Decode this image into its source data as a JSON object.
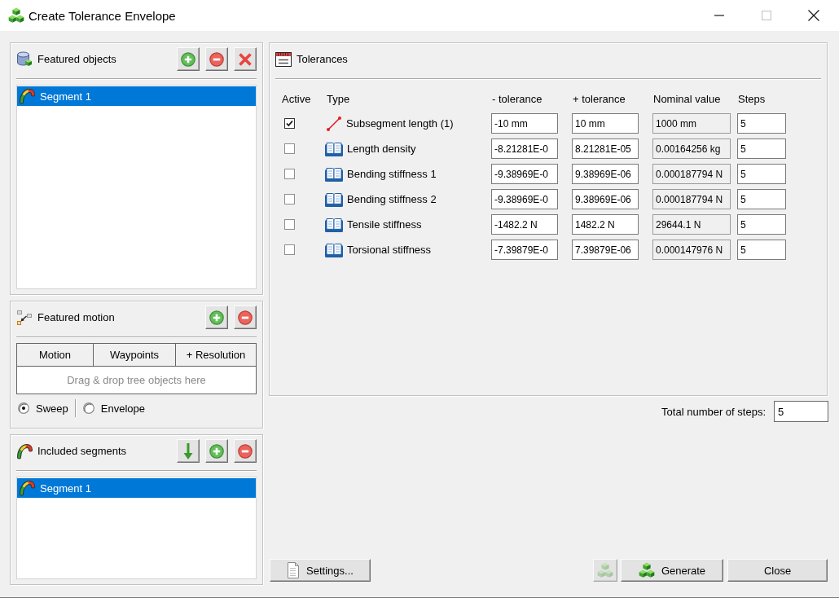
{
  "window": {
    "title": "Create Tolerance Envelope",
    "controls": [
      {
        "kind": "minimize",
        "disabled": false
      },
      {
        "kind": "maximize",
        "disabled": true
      },
      {
        "kind": "close",
        "disabled": false
      }
    ]
  },
  "featured_objects": {
    "title": "Featured objects",
    "tools": [
      {
        "kind": "add"
      },
      {
        "kind": "remove"
      },
      {
        "kind": "delete"
      }
    ],
    "items": [
      {
        "label": "Segment 1",
        "selected": true
      }
    ]
  },
  "featured_motion": {
    "title": "Featured motion",
    "tools": [
      {
        "kind": "add"
      },
      {
        "kind": "remove"
      }
    ],
    "columns": [
      "Motion",
      "Waypoints",
      "+ Resolution"
    ],
    "placeholder": "Drag & drop tree objects here",
    "modes": [
      {
        "label": "Sweep",
        "selected": true
      },
      {
        "label": "Envelope",
        "selected": false
      }
    ]
  },
  "included_segments": {
    "title": "Included segments",
    "tools": [
      {
        "kind": "move_down"
      },
      {
        "kind": "add"
      },
      {
        "kind": "remove"
      }
    ],
    "items": [
      {
        "label": "Segment 1",
        "selected": true
      }
    ]
  },
  "tolerances": {
    "title": "Tolerances",
    "columns": [
      "Active",
      "Type",
      "- tolerance",
      "+ tolerance",
      "Nominal value",
      "Steps"
    ],
    "rows": [
      {
        "active": true,
        "kind": "length",
        "type": "Subsegment length (1)",
        "minus": "-10 mm",
        "plus": "10 mm",
        "nominal": "1000 mm",
        "steps": "5"
      },
      {
        "active": false,
        "kind": "property",
        "type": "Length density",
        "minus": "-8.21281E-0",
        "plus": "8.21281E-05",
        "nominal": "0.00164256 kg",
        "steps": "5"
      },
      {
        "active": false,
        "kind": "property",
        "type": "Bending stiffness 1",
        "minus": "-9.38969E-0",
        "plus": "9.38969E-06",
        "nominal": "0.000187794 N",
        "steps": "5"
      },
      {
        "active": false,
        "kind": "property",
        "type": "Bending stiffness 2",
        "minus": "-9.38969E-0",
        "plus": "9.38969E-06",
        "nominal": "0.000187794 N",
        "steps": "5"
      },
      {
        "active": false,
        "kind": "property",
        "type": "Tensile stiffness",
        "minus": "-1482.2 N",
        "plus": "1482.2 N",
        "nominal": "29644.1 N",
        "steps": "5"
      },
      {
        "active": false,
        "kind": "property",
        "type": "Torsional stiffness",
        "minus": "-7.39879E-0",
        "plus": "7.39879E-06",
        "nominal": "0.000147976 N",
        "steps": "5"
      }
    ]
  },
  "total_steps": {
    "label": "Total number of steps:",
    "value": "5"
  },
  "buttons": [
    {
      "kind": "settings",
      "label": "Settings..."
    },
    {
      "kind": "cubes",
      "disabled": true
    },
    {
      "kind": "generate",
      "label": "Generate"
    },
    {
      "kind": "close",
      "label": "Close"
    }
  ]
}
